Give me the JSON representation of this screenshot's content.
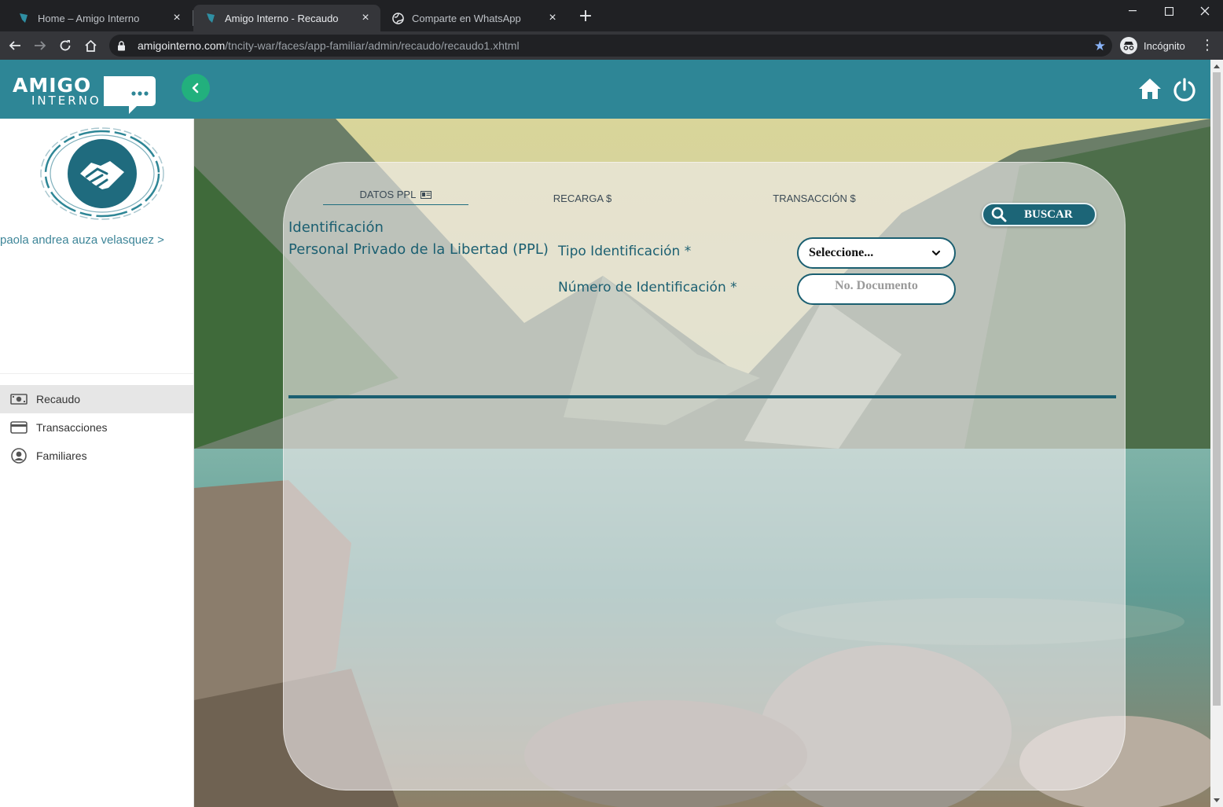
{
  "browser": {
    "tabs": [
      {
        "title": "Home – Amigo Interno",
        "active": false
      },
      {
        "title": "Amigo Interno - Recaudo",
        "active": true
      },
      {
        "title": "Comparte en WhatsApp",
        "active": false
      }
    ],
    "url_host": "amigointerno.com",
    "url_path": "/tncity-war/faces/app-familiar/admin/recaudo/recaudo1.xhtml",
    "profile_label": "Incógnito",
    "colors": {
      "chrome_bg": "#202124",
      "toolbar_bg": "#35363a",
      "star": "#8ab4f8"
    }
  },
  "header": {
    "logo_text_top": "AMIGO",
    "logo_text_bottom": "INTERNO",
    "colors": {
      "topbar": "#2e8696",
      "collapse_button": "#22b07d"
    }
  },
  "sidebar": {
    "user_name": "paola andrea auza velasquez >",
    "items": [
      {
        "label": "Recaudo",
        "icon": "money-icon",
        "active": true
      },
      {
        "label": "Transacciones",
        "icon": "credit-card-icon",
        "active": false
      },
      {
        "label": "Familiares",
        "icon": "user-circle-icon",
        "active": false
      }
    ]
  },
  "main": {
    "tabs": [
      {
        "label": "DATOS PPL",
        "active": true
      },
      {
        "label": "RECARGA $",
        "active": false
      },
      {
        "label": "TRANSACCIÓN $",
        "active": false
      }
    ],
    "search_button": "BUSCAR",
    "section_title": "Identificación",
    "section_subtitle": "Personal Privado de la Libertad (PPL)",
    "fields": {
      "id_type_label": "Tipo Identificación *",
      "id_type_value": "Seleccione...",
      "id_number_label": "Número de Identificación *",
      "id_number_placeholder": "No. Documento"
    },
    "colors": {
      "primary_text": "#1b5f71",
      "button": "#1c6577"
    }
  }
}
